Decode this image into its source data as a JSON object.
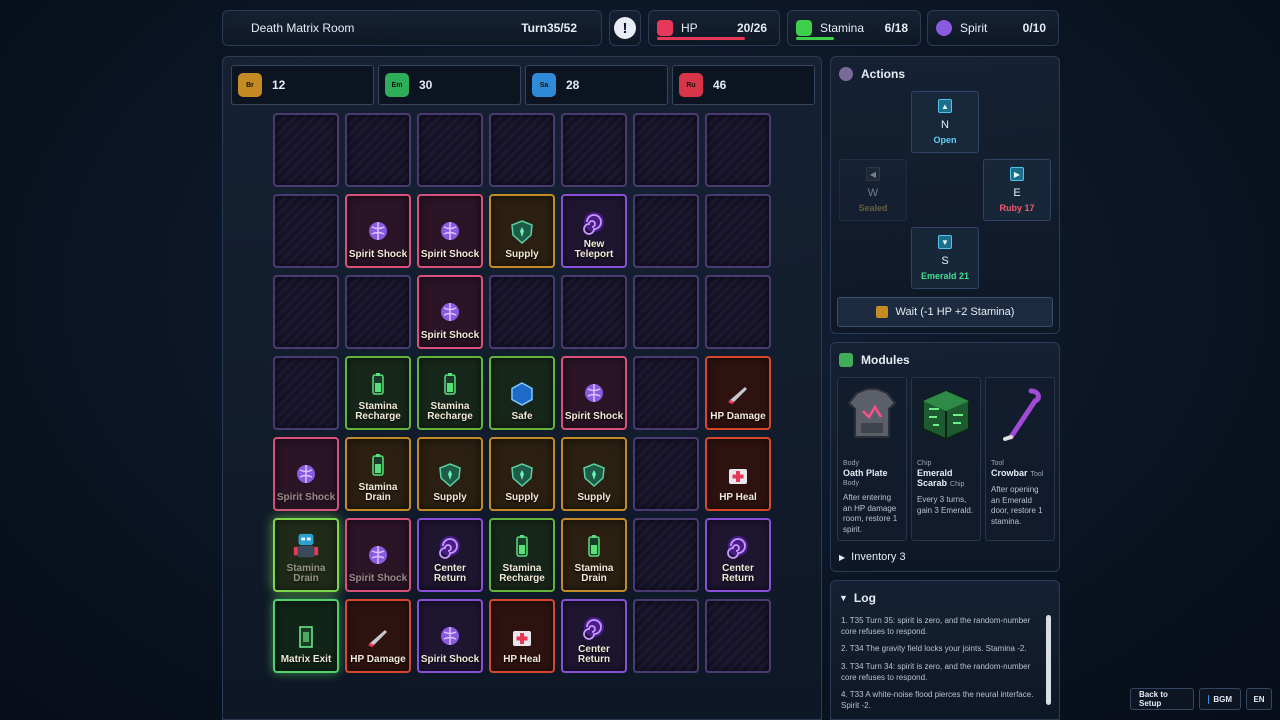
{
  "header": {
    "room_name": "Death Matrix Room",
    "turn": "Turn35/52",
    "alert_symbol": "!"
  },
  "stats": {
    "hp": {
      "label": "HP",
      "value": "20/26",
      "fill": 0.77,
      "color": "#e8385a"
    },
    "stamina": {
      "label": "Stamina",
      "value": "6/18",
      "fill": 0.33,
      "color": "#3fcf4a"
    },
    "spirit": {
      "label": "Spirit",
      "value": "0/10",
      "fill": 0.0,
      "color": "#8a5ae0"
    }
  },
  "resources": [
    {
      "name": "Br",
      "value": "12",
      "color": "#c48a24"
    },
    {
      "name": "Em",
      "value": "30",
      "color": "#2fae5a"
    },
    {
      "name": "Sa",
      "value": "28",
      "color": "#2f8ad8"
    },
    {
      "name": "Ru",
      "value": "46",
      "color": "#d8354a"
    }
  ],
  "grid": {
    "rows": [
      [
        {
          "type": "empty",
          "label": ""
        },
        {
          "type": "empty",
          "label": ""
        },
        {
          "type": "empty",
          "label": ""
        },
        {
          "type": "empty",
          "label": ""
        },
        {
          "type": "empty",
          "label": ""
        },
        {
          "type": "empty",
          "label": ""
        },
        {
          "type": "empty",
          "label": ""
        }
      ],
      [
        {
          "type": "empty",
          "label": ""
        },
        {
          "type": "pink",
          "label": "Spirit Shock",
          "icon": "brain-icon"
        },
        {
          "type": "pink",
          "label": "Spirit Shock",
          "icon": "brain-icon"
        },
        {
          "type": "gold",
          "label": "Supply",
          "icon": "shield-icon"
        },
        {
          "type": "purple",
          "label": "New Teleport",
          "icon": "portal-icon"
        },
        {
          "type": "empty",
          "label": ""
        },
        {
          "type": "empty",
          "label": ""
        }
      ],
      [
        {
          "type": "empty",
          "label": ""
        },
        {
          "type": "empty",
          "label": ""
        },
        {
          "type": "pink",
          "label": "Spirit Shock",
          "icon": "brain-icon"
        },
        {
          "type": "empty",
          "label": ""
        },
        {
          "type": "empty",
          "label": ""
        },
        {
          "type": "empty",
          "label": ""
        },
        {
          "type": "empty",
          "label": ""
        }
      ],
      [
        {
          "type": "empty",
          "label": ""
        },
        {
          "type": "green",
          "label": "Stamina Recharge",
          "icon": "battery-icon"
        },
        {
          "type": "green",
          "label": "Stamina Recharge",
          "icon": "battery-icon"
        },
        {
          "type": "green",
          "label": "Safe",
          "icon": "hexagon-icon"
        },
        {
          "type": "pink",
          "label": "Spirit Shock",
          "icon": "brain-icon"
        },
        {
          "type": "empty",
          "label": ""
        },
        {
          "type": "red",
          "label": "HP Damage",
          "icon": "blade-icon"
        }
      ],
      [
        {
          "type": "pink",
          "label": "Spirit Shock",
          "icon": "brain-icon",
          "visited": true
        },
        {
          "type": "gold",
          "label": "Stamina Drain",
          "icon": "battery-icon"
        },
        {
          "type": "gold",
          "label": "Supply",
          "icon": "shield-icon"
        },
        {
          "type": "gold",
          "label": "Supply",
          "icon": "shield-icon"
        },
        {
          "type": "gold",
          "label": "Supply",
          "icon": "shield-icon"
        },
        {
          "type": "empty",
          "label": ""
        },
        {
          "type": "red",
          "label": "HP Heal",
          "icon": "medkit-icon"
        }
      ],
      [
        {
          "type": "player",
          "label": "Stamina Drain",
          "icon": "robot-icon",
          "visited": true
        },
        {
          "type": "pink",
          "label": "Spirit Shock",
          "icon": "brain-icon",
          "visited": true
        },
        {
          "type": "purple",
          "label": "Center Return",
          "icon": "portal-icon"
        },
        {
          "type": "green",
          "label": "Stamina Recharge",
          "icon": "battery-icon"
        },
        {
          "type": "gold",
          "label": "Stamina Drain",
          "icon": "battery-icon"
        },
        {
          "type": "empty",
          "label": ""
        },
        {
          "type": "purple",
          "label": "Center Return",
          "icon": "portal-icon"
        }
      ],
      [
        {
          "type": "exit",
          "label": "Matrix Exit",
          "icon": "exit-icon"
        },
        {
          "type": "red",
          "label": "HP Damage",
          "icon": "blade-icon"
        },
        {
          "type": "purple",
          "label": "Spirit Shock",
          "icon": "brain-icon"
        },
        {
          "type": "red",
          "label": "HP Heal",
          "icon": "medkit-icon"
        },
        {
          "type": "purple",
          "label": "Center Return",
          "icon": "portal-icon"
        },
        {
          "type": "empty",
          "label": ""
        },
        {
          "type": "empty",
          "label": ""
        }
      ]
    ]
  },
  "actions": {
    "title": "Actions",
    "north": {
      "dir": "N",
      "state": "Open",
      "color": "#5fd0f0"
    },
    "west": {
      "dir": "W",
      "state": "Sealed",
      "color": "#c8a850"
    },
    "east": {
      "dir": "E",
      "state": "Ruby 17",
      "color": "#f05a6a"
    },
    "south": {
      "dir": "S",
      "state": "Emerald 21",
      "color": "#3fe08a"
    },
    "wait_label": "Wait  (-1 HP +2 Stamina)"
  },
  "modules": {
    "title": "Modules",
    "items": [
      {
        "type": "Body",
        "name": "Oath Plate",
        "tag": "",
        "sub": "Body",
        "desc": "After entering an HP damage room, restore 1 spirit.",
        "icon": "armor-icon"
      },
      {
        "type": "Chip",
        "name": "Emerald Scarab",
        "tag": "Chip",
        "sub": "",
        "desc": "Every 3 turns, gain 3 Emerald.",
        "icon": "chip-cube-icon"
      },
      {
        "type": "Tool",
        "name": "Crowbar",
        "tag": "Tool",
        "sub": "",
        "desc": "After opening an Emerald door, restore 1 stamina.",
        "icon": "crowbar-icon"
      }
    ],
    "inventory_label": "Inventory 3"
  },
  "log": {
    "title": "Log",
    "entries": [
      "1. T35 Turn 35: spirit is zero, and the random-number core refuses to respond.",
      "2. T34 The gravity field locks your joints. Stamina -2.",
      "3. T34 Turn 34: spirit is zero, and the random-number core refuses to respond.",
      "4. T33 A white-noise flood pierces the neural interface. Spirit -2."
    ]
  },
  "footer": {
    "back_label": "Back to Setup",
    "bgm_label": "BGM",
    "lang_label": "EN"
  }
}
